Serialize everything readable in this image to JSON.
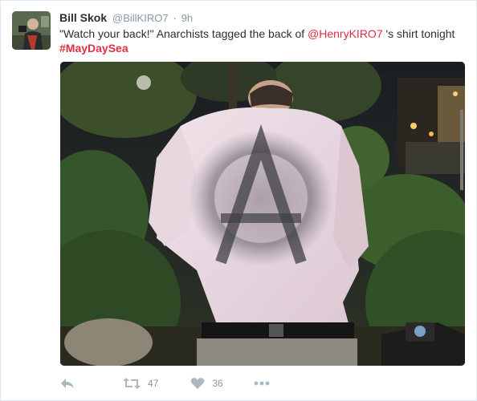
{
  "tweet": {
    "author_name": "Bill Skok",
    "author_handle": "@BillKIRO7",
    "separator": "·",
    "timestamp": "9h",
    "text_part1": "\"Watch your back!\" Anarchists tagged the back of ",
    "mention": "@HenryKIRO7",
    "text_part2": " 's shirt tonight",
    "hashtag": "#MayDaySea"
  },
  "actions": {
    "reply_icon": "reply-icon",
    "retweet_icon": "retweet-icon",
    "retweet_count": "47",
    "like_icon": "heart-icon",
    "like_count": "36",
    "more_icon": "more-dots-icon"
  },
  "colors": {
    "link": "#dd2e44",
    "text": "#292f33",
    "muted": "#8899a6",
    "icon": "#aab8c2"
  }
}
